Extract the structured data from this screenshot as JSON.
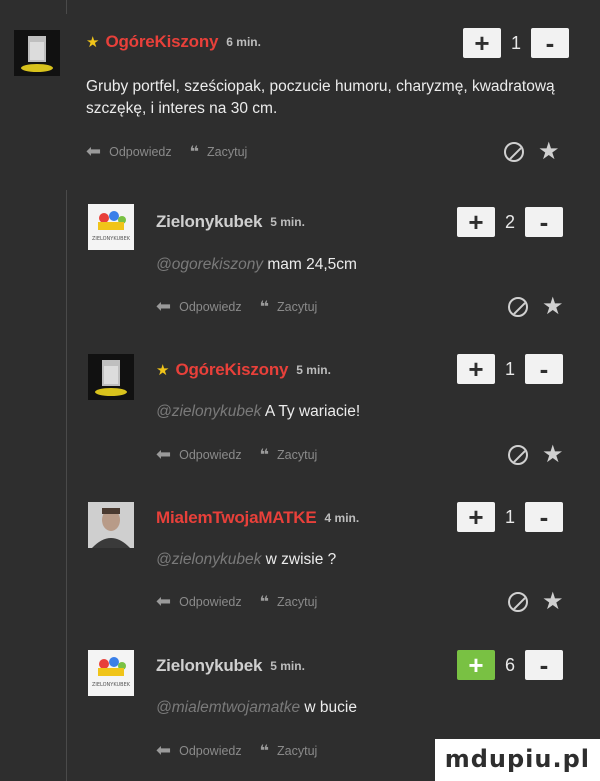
{
  "comments": [
    {
      "author": "OgóreKiszony",
      "time": "6 min.",
      "starred": true,
      "author_color": "#e8403a",
      "text": "Gruby portfel, sześciopak, poczucie humoru, charyzmę, kwadratową szczękę, i interes na 30 cm.",
      "mention": "",
      "votes": "1",
      "reply_label": "Odpowiedz",
      "quote_label": "Zacytuj",
      "avatar_icon": "glass-avatar"
    },
    {
      "author": "Zielonykubek",
      "time": "5 min.",
      "starred": false,
      "author_color": "#cfcfcf",
      "mention": "@ogorekiszony",
      "text": "mam 24,5cm",
      "votes": "2",
      "reply_label": "Odpowiedz",
      "quote_label": "Zacytuj",
      "avatar_icon": "cartoon-avatar"
    },
    {
      "author": "OgóreKiszony",
      "time": "5 min.",
      "starred": true,
      "author_color": "#e8403a",
      "mention": "@zielonykubek",
      "text": "A Ty wariacie!",
      "votes": "1",
      "reply_label": "Odpowiedz",
      "quote_label": "Zacytuj",
      "avatar_icon": "glass-avatar"
    },
    {
      "author": "MialemTwojaMATKE",
      "time": "4 min.",
      "starred": false,
      "author_color": "#e8403a",
      "mention": "@zielonykubek",
      "text": "w zwisie ?",
      "votes": "1",
      "reply_label": "Odpowiedz",
      "quote_label": "Zacytuj",
      "avatar_icon": "photo-avatar"
    },
    {
      "author": "Zielonykubek",
      "time": "5 min.",
      "starred": false,
      "author_color": "#cfcfcf",
      "mention": "@mialemtwojamatke",
      "text": "w bucie",
      "votes": "6",
      "upvoted": true,
      "reply_label": "Odpowiedz",
      "quote_label": "Zacytuj",
      "avatar_icon": "cartoon-avatar"
    }
  ],
  "controls": {
    "plus": "+",
    "minus": "-",
    "star_badge": "★",
    "reply_icon": "reply-arrow-icon",
    "quote_icon": "quote-icon",
    "block_icon": "block-icon",
    "fav_icon": "star-icon",
    "cartoon_text": "ZIELONYKUBEK"
  },
  "accent": {
    "red": "#e8403a",
    "green": "#79c143",
    "gold": "#f0c419"
  },
  "watermark": "mdupiu.pl"
}
